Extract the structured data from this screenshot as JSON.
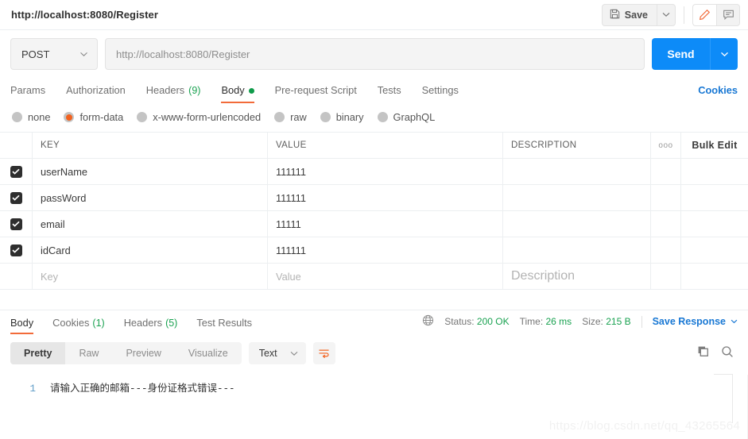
{
  "titlebar": {
    "request_title": "http://localhost:8080/Register",
    "save_label": "Save",
    "save_caret": "∨",
    "edit_icon": "pencil-icon",
    "comment_icon": "comment-icon"
  },
  "url_row": {
    "method": "POST",
    "method_caret": "∨",
    "url_placeholder": "http://localhost:8080/Register",
    "url_value": "http://localhost:8080/Register",
    "send_label": "Send",
    "send_caret": "∨"
  },
  "request_tabs": {
    "items": [
      {
        "label": "Params",
        "count": "",
        "dot": false,
        "active": false
      },
      {
        "label": "Authorization",
        "count": "",
        "dot": false,
        "active": false
      },
      {
        "label": "Headers",
        "count": "(9)",
        "dot": false,
        "active": false
      },
      {
        "label": "Body",
        "count": "",
        "dot": true,
        "active": true
      },
      {
        "label": "Pre-request Script",
        "count": "",
        "dot": false,
        "active": false
      },
      {
        "label": "Tests",
        "count": "",
        "dot": false,
        "active": false
      },
      {
        "label": "Settings",
        "count": "",
        "dot": false,
        "active": false
      }
    ],
    "cookies_label": "Cookies"
  },
  "body_types": [
    {
      "label": "none",
      "selected": false
    },
    {
      "label": "form-data",
      "selected": true
    },
    {
      "label": "x-www-form-urlencoded",
      "selected": false
    },
    {
      "label": "raw",
      "selected": false
    },
    {
      "label": "binary",
      "selected": false
    },
    {
      "label": "GraphQL",
      "selected": false
    }
  ],
  "kv_table": {
    "headers": {
      "key": "KEY",
      "value": "VALUE",
      "description": "DESCRIPTION",
      "more": "ooo",
      "bulk_edit": "Bulk Edit"
    },
    "rows": [
      {
        "checked": true,
        "key": "userName",
        "value": "111111",
        "description": ""
      },
      {
        "checked": true,
        "key": "passWord",
        "value": "111111",
        "description": ""
      },
      {
        "checked": true,
        "key": "email",
        "value": "11111",
        "description": ""
      },
      {
        "checked": true,
        "key": "idCard",
        "value": "111111",
        "description": ""
      }
    ],
    "placeholder_row": {
      "key": "Key",
      "value": "Value",
      "description": "Description"
    }
  },
  "response_tabs": {
    "items": [
      {
        "label": "Body",
        "count": "",
        "active": true
      },
      {
        "label": "Cookies",
        "count": "(1)",
        "active": false
      },
      {
        "label": "Headers",
        "count": "(5)",
        "active": false
      },
      {
        "label": "Test Results",
        "count": "",
        "active": false
      }
    ],
    "globe_icon": "globe-icon",
    "status_label": "Status:",
    "status_value": "200 OK",
    "time_label": "Time:",
    "time_value": "26 ms",
    "size_label": "Size:",
    "size_value": "215 B",
    "save_response_label": "Save Response",
    "save_response_caret": "∨"
  },
  "format_bar": {
    "segments": [
      {
        "label": "Pretty",
        "active": true
      },
      {
        "label": "Raw",
        "active": false
      },
      {
        "label": "Preview",
        "active": false
      },
      {
        "label": "Visualize",
        "active": false
      }
    ],
    "language": "Text",
    "language_caret": "∨",
    "wrap_icon": "word-wrap-icon",
    "copy_icon": "copy-icon",
    "search_icon": "search-icon"
  },
  "response_body": {
    "line_number": "1",
    "text": "请输入正确的邮箱---身份证格式错误---"
  },
  "watermark": "https://blog.csdn.net/qq_43265564",
  "colors": {
    "accent_orange": "#f26b3a",
    "link_blue": "#1978d4",
    "send_blue": "#0d8bf8",
    "success_green": "#1aa251",
    "dot_green": "#0f9b4a"
  }
}
